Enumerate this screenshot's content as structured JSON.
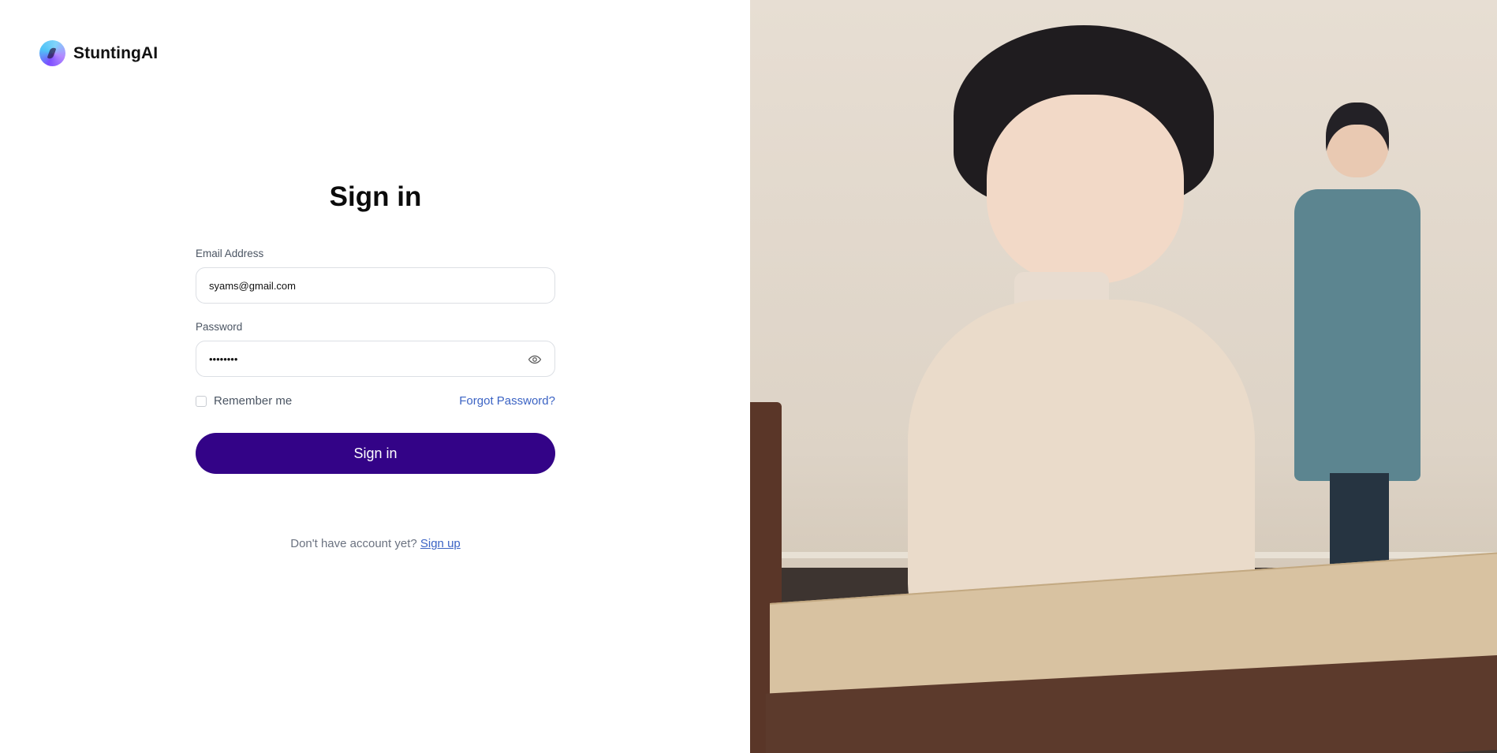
{
  "brand": {
    "name": "StuntingAI"
  },
  "form": {
    "title": "Sign in",
    "email_label": "Email Address",
    "email_value": "syams@gmail.com",
    "password_label": "Password",
    "password_value": "••••••••",
    "remember_label": "Remember me",
    "forgot_label": "Forgot Password?",
    "submit_label": "Sign in",
    "signup_prompt": "Don't have account yet?",
    "signup_link": "Sign up"
  },
  "icons": {
    "logo": "brand-logo-icon",
    "password_toggle": "eye-icon"
  },
  "colors": {
    "primary_button": "#330387",
    "link": "#3b63c4"
  }
}
